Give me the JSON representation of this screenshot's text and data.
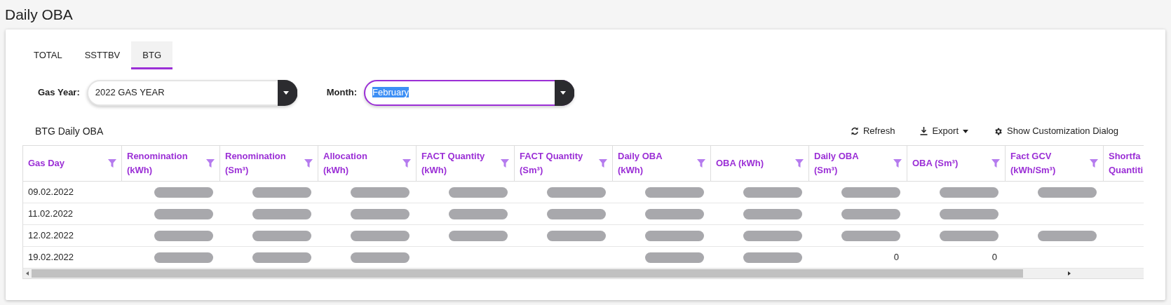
{
  "page_title": "Daily OBA",
  "tabs": [
    {
      "label": "TOTAL",
      "selected": false
    },
    {
      "label": "SSTTBV",
      "selected": false
    },
    {
      "label": "BTG",
      "selected": true
    }
  ],
  "filters": [
    {
      "label": "Gas Year:",
      "value": "2022 GAS YEAR",
      "focused": false
    },
    {
      "label": "Month:",
      "value": "February",
      "focused": true
    }
  ],
  "grid": {
    "title": "BTG Daily OBA",
    "toolbar": [
      {
        "kind": "refresh",
        "label": "Refresh"
      },
      {
        "kind": "export",
        "label": "Export"
      },
      {
        "kind": "settings",
        "label": "Show Customization Dialog"
      }
    ],
    "columns": [
      {
        "label": "Gas Day",
        "filter": true
      },
      {
        "label": "Renomination (kWh)",
        "filter": true
      },
      {
        "label": "Renomination (Sm³)",
        "filter": true
      },
      {
        "label": "Allocation (kWh)",
        "filter": true
      },
      {
        "label": "FACT Quantity (kWh)",
        "filter": true
      },
      {
        "label": "FACT Quantity (Sm³)",
        "filter": true
      },
      {
        "label": "Daily OBA (kWh)",
        "filter": true
      },
      {
        "label": "OBA (kWh)",
        "filter": true
      },
      {
        "label": "Daily OBA (Sm³)",
        "filter": true
      },
      {
        "label": "OBA (Sm³)",
        "filter": true
      },
      {
        "label": "Fact GCV (kWh/Sm³)",
        "filter": true
      },
      {
        "label": "Shortfa Quantiti"
      }
    ],
    "rows": [
      {
        "cells": [
          {
            "kind": "text",
            "text": "09.02.2022"
          },
          {
            "kind": "redacted"
          },
          {
            "kind": "redacted"
          },
          {
            "kind": "redacted"
          },
          {
            "kind": "redacted"
          },
          {
            "kind": "redacted"
          },
          {
            "kind": "redacted"
          },
          {
            "kind": "redacted"
          },
          {
            "kind": "redacted"
          },
          {
            "kind": "redacted"
          },
          {
            "kind": "redacted"
          },
          {
            "kind": "empty"
          }
        ]
      },
      {
        "cells": [
          {
            "kind": "text",
            "text": "11.02.2022"
          },
          {
            "kind": "redacted"
          },
          {
            "kind": "redacted"
          },
          {
            "kind": "redacted"
          },
          {
            "kind": "redacted"
          },
          {
            "kind": "redacted"
          },
          {
            "kind": "redacted"
          },
          {
            "kind": "redacted"
          },
          {
            "kind": "redacted"
          },
          {
            "kind": "redacted"
          },
          {
            "kind": "empty"
          },
          {
            "kind": "empty"
          }
        ]
      },
      {
        "cells": [
          {
            "kind": "text",
            "text": "12.02.2022"
          },
          {
            "kind": "redacted"
          },
          {
            "kind": "redacted"
          },
          {
            "kind": "redacted"
          },
          {
            "kind": "redacted"
          },
          {
            "kind": "redacted"
          },
          {
            "kind": "redacted"
          },
          {
            "kind": "redacted"
          },
          {
            "kind": "redacted"
          },
          {
            "kind": "redacted"
          },
          {
            "kind": "redacted"
          },
          {
            "kind": "empty"
          }
        ]
      },
      {
        "cells": [
          {
            "kind": "text",
            "text": "19.02.2022"
          },
          {
            "kind": "redacted"
          },
          {
            "kind": "redacted"
          },
          {
            "kind": "redacted"
          },
          {
            "kind": "empty"
          },
          {
            "kind": "empty"
          },
          {
            "kind": "redacted"
          },
          {
            "kind": "redacted"
          },
          {
            "kind": "text",
            "text": "0"
          },
          {
            "kind": "text",
            "text": "0"
          },
          {
            "kind": "empty"
          },
          {
            "kind": "empty"
          }
        ]
      }
    ]
  }
}
